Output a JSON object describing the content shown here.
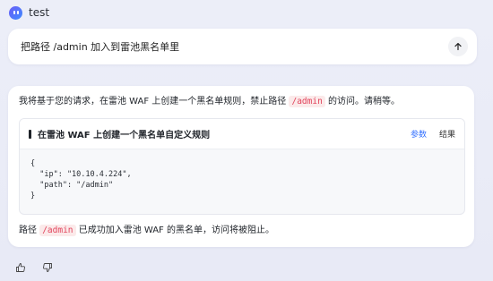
{
  "app": {
    "title": "test"
  },
  "prompt": {
    "text": "把路径 /admin 加入到雷池黑名单里",
    "send_icon": "arrow-up-icon"
  },
  "answer": {
    "intro_before": "我将基于您的请求，在雷池 WAF 上创建一个黑名单规则，禁止路径 ",
    "intro_code": "/admin",
    "intro_after": " 的访问。请稍等。",
    "tool": {
      "title": "在雷池 WAF 上创建一个黑名单自定义规则",
      "tabs": [
        "参数",
        "结果"
      ],
      "active_tab": "参数",
      "code": "{\n  \"ip\": \"10.10.4.224\",\n  \"path\": \"/admin\"\n}"
    },
    "result_before": "路径 ",
    "result_code": "/admin",
    "result_after": " 已成功加入雷池 WAF 的黑名单，访问将被阻止。"
  },
  "feedback": {
    "like_icon": "thumbs-up-icon",
    "dislike_icon": "thumbs-down-icon"
  },
  "colors": {
    "accent": "#3370ff",
    "code_red": "#e2445c",
    "logo": "#5b6cf8"
  }
}
